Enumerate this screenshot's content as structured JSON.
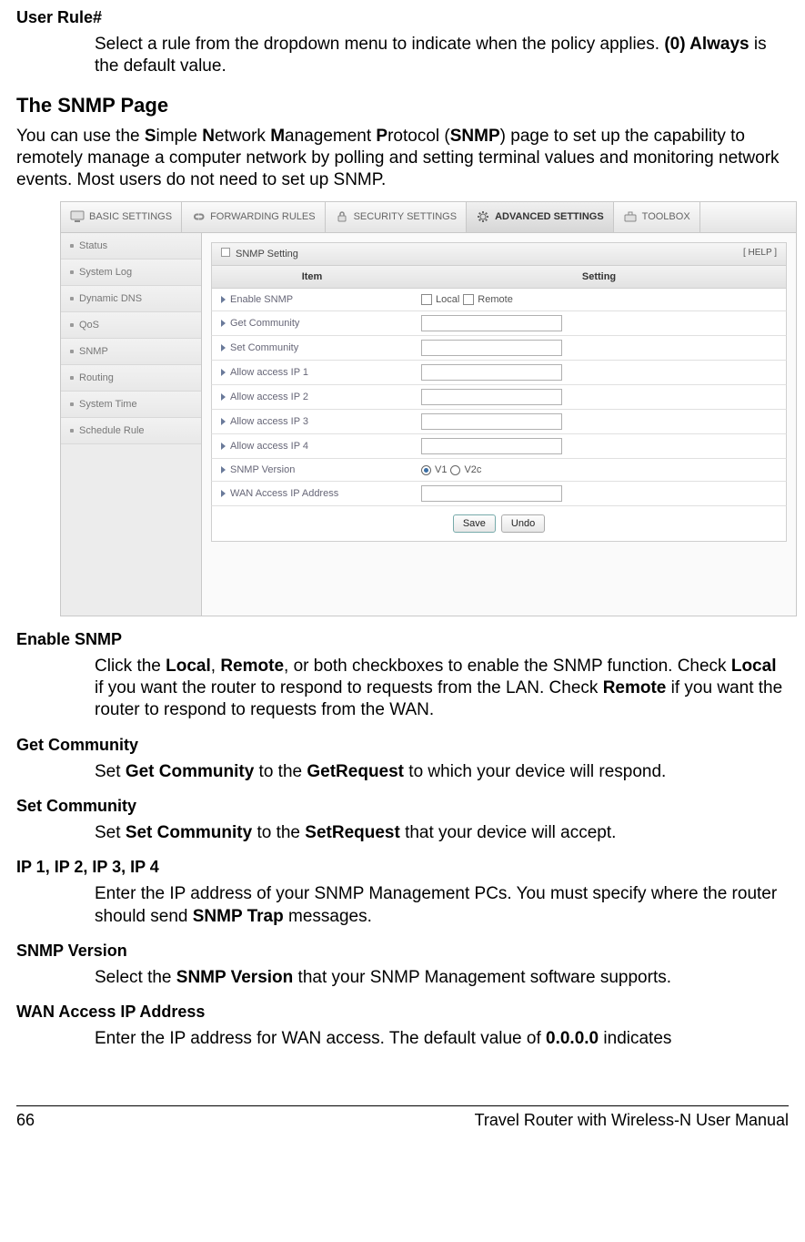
{
  "fields": {
    "user_rule": {
      "title": "User Rule#",
      "body_pre": "Select a rule from the dropdown menu to indicate when the policy applies. ",
      "bold1": "(0) Always",
      "body_post": " is the default value."
    }
  },
  "section": {
    "title": "The SNMP Page",
    "intro_pre": "You can use the ",
    "s_bold": "S",
    "s_rest": "imple ",
    "n_bold": "N",
    "n_rest": "etwork ",
    "m_bold": "M",
    "m_rest": "anagement ",
    "p_bold": "P",
    "p_rest": "rotocol (",
    "snmp_bold": "SNMP",
    "intro_post": ") page to set up the capability to remotely manage a computer network by polling and setting terminal values and monitoring network events. Most users do not need to set up SNMP."
  },
  "screenshot": {
    "tabs": [
      "BASIC SETTINGS",
      "FORWARDING RULES",
      "SECURITY SETTINGS",
      "ADVANCED SETTINGS",
      "TOOLBOX"
    ],
    "active_tab_index": 3,
    "sidebar": [
      "Status",
      "System Log",
      "Dynamic DNS",
      "QoS",
      "SNMP",
      "Routing",
      "System Time",
      "Schedule Rule"
    ],
    "panel_title": "SNMP Setting",
    "help_text": "[ HELP ]",
    "col_item": "Item",
    "col_setting": "Setting",
    "rows": {
      "enable_snmp": "Enable SNMP",
      "local": "Local",
      "remote": "Remote",
      "get_community": "Get Community",
      "set_community": "Set Community",
      "allow_ip1": "Allow access IP 1",
      "allow_ip2": "Allow access IP 2",
      "allow_ip3": "Allow access IP 3",
      "allow_ip4": "Allow access IP 4",
      "snmp_version": "SNMP Version",
      "v1": "V1",
      "v2c": "V2c",
      "wan_access": "WAN Access IP Address"
    },
    "buttons": {
      "save": "Save",
      "undo": "Undo"
    }
  },
  "defs": {
    "enable_snmp": {
      "title": "Enable SNMP",
      "line1_pre": "Click the ",
      "local": "Local",
      "comma": ", ",
      "remote": "Remote",
      "line1_post": ", or both checkboxes to enable the SNMP function. Check ",
      "local2": "Local",
      "line2_post": " if you want the router to respond to requests from the LAN. Check ",
      "remote2": "Remote",
      "line3_post": " if you want the router to respond to requests from the WAN."
    },
    "get_community": {
      "title": "Get Community",
      "pre": "Set ",
      "b1": "Get Community",
      "mid": " to the ",
      "b2": "GetRequest",
      "post": " to which your device will respond."
    },
    "set_community": {
      "title": "Set Community",
      "pre": "Set ",
      "b1": "Set Community",
      "mid": " to the ",
      "b2": "SetRequest",
      "post": " that your device will accept."
    },
    "ips": {
      "title": "IP 1, IP 2, IP 3, IP 4",
      "pre": "Enter the IP address of your SNMP Management PCs. You must specify where the router should send ",
      "b1": "SNMP Trap",
      "post": " messages."
    },
    "snmp_version": {
      "title": "SNMP Version",
      "pre": "Select the ",
      "b1": "SNMP Version",
      "post": " that your SNMP Management software supports."
    },
    "wan_access": {
      "title": "WAN Access IP Address",
      "pre": "Enter the IP address for WAN access. The default value of ",
      "b1": "0.0.0.0",
      "post": " indicates"
    }
  },
  "footer": {
    "page": "66",
    "title": "Travel Router with Wireless-N User Manual"
  }
}
